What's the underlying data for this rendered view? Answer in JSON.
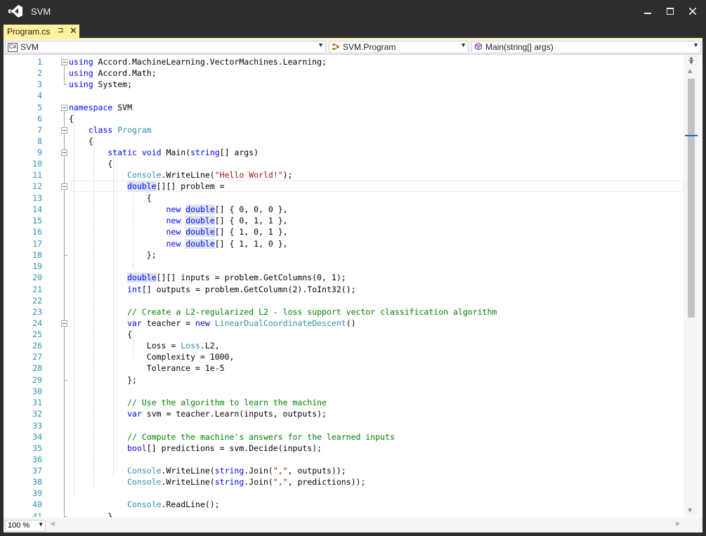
{
  "window": {
    "title": "SVM"
  },
  "tab": {
    "label": "Program.cs",
    "pin_glyph": "⊐",
    "close_glyph": "✕"
  },
  "navbar": {
    "project_badge": "C#",
    "project": "SVM",
    "class": "SVM.Program",
    "member": "Main(string[] args)"
  },
  "editor": {
    "zoom": "100 %",
    "current_line": 12,
    "lines": [
      "<span class=\"k\">using</span> Accord.MachineLearning.VectorMachines.Learning;",
      "<span class=\"k\">using</span> Accord.Math;",
      "<span class=\"k\">using</span> System;",
      "",
      "<span class=\"k\">namespace</span> SVM",
      "{",
      "    <span class=\"k\">class</span> <span class=\"t\">Program</span>",
      "    {",
      "        <span class=\"k\">static</span> <span class=\"k\">void</span> Main(<span class=\"k\">string</span>[] args)",
      "        {",
      "            <span class=\"t\">Console</span>.WriteLine(<span class=\"s\">\"Hello World!\"</span>);",
      "            <span class=\"k hl\">double</span>[][] problem =",
      "                {",
      "                    <span class=\"k\">new</span> <span class=\"k hl\">double</span>[] { 0, 0, 0 },",
      "                    <span class=\"k\">new</span> <span class=\"k hl\">double</span>[] { 0, 1, 1 },",
      "                    <span class=\"k\">new</span> <span class=\"k hl\">double</span>[] { 1, 0, 1 },",
      "                    <span class=\"k\">new</span> <span class=\"k hl\">double</span>[] { 1, 1, 0 },",
      "                };",
      "",
      "            <span class=\"k hl\">double</span>[][] inputs = problem.GetColumns(0, 1);",
      "            <span class=\"k\">int</span>[] outputs = problem.GetColumn(2).ToInt32();",
      "",
      "            <span class=\"c\">// Create a L2-regularized L2 - loss support vector classification algorithm</span>",
      "            <span class=\"k\">var</span> teacher = <span class=\"k\">new</span> <span class=\"t\">LinearDualCoordinateDescent</span>()",
      "            {",
      "                Loss = <span class=\"t\">Loss</span>.L2,",
      "                Complexity = 1000,",
      "                Tolerance = 1e-5",
      "            };",
      "",
      "            <span class=\"c\">// Use the algorithm to learn the machine</span>",
      "            <span class=\"k\">var</span> svm = teacher.Learn(inputs, outputs);",
      "",
      "            <span class=\"c\">// Compute the machine's answers for the learned inputs</span>",
      "            <span class=\"k\">bool</span>[] predictions = svm.Decide(inputs);",
      "",
      "            <span class=\"t\">Console</span>.WriteLine(<span class=\"k\">string</span>.Join(<span class=\"s\">\",\"</span>, outputs));",
      "            <span class=\"t\">Console</span>.WriteLine(<span class=\"k\">string</span>.Join(<span class=\"s\">\",\"</span>, predictions));",
      "",
      "            <span class=\"t\">Console</span>.ReadLine();",
      "        }",
      "    }",
      "}",
      ""
    ]
  },
  "colors": {
    "keyword": "#0000ff",
    "type": "#2b91af",
    "string": "#a31515",
    "comment": "#008000",
    "tab_active": "#fff29d",
    "chrome": "#2d2d30"
  },
  "icons": {
    "logo": "visual-studio-logo-icon",
    "minimize": "minimize-icon",
    "maximize": "maximize-icon",
    "close": "close-icon",
    "member": "method-cube-icon",
    "split": "split-editor-icon"
  }
}
